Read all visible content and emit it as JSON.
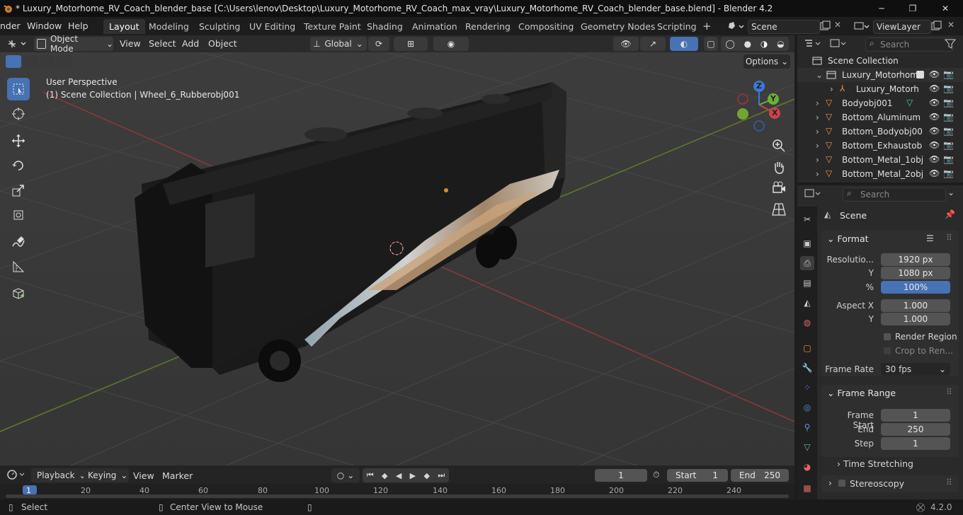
{
  "titlebar": {
    "title": "* Luxury_Motorhome_RV_Coach_blender_base [C:\\Users\\lenov\\Desktop\\Luxury_Motorhome_RV_Coach_max_vray\\Luxury_Motorhome_RV_Coach_blender_base.blend] - Blender 4.2",
    "minimize": "─",
    "maximize": "❐",
    "close": "✕"
  },
  "menubar": {
    "menus": [
      "nder",
      "Window",
      "Help"
    ],
    "workspaces": [
      "Layout",
      "Modeling",
      "Sculpting",
      "UV Editing",
      "Texture Paint",
      "Shading",
      "Animation",
      "Rendering",
      "Compositing",
      "Geometry Nodes",
      "Scripting"
    ],
    "active_workspace": "Layout",
    "add_tab": "+",
    "scene": "Scene",
    "view_layer": "ViewLayer"
  },
  "viewport": {
    "mode": "Object Mode",
    "menus": [
      "View",
      "Select",
      "Add",
      "Object"
    ],
    "transform": "Global",
    "options": "Options",
    "perspective": "User Perspective",
    "collection_info": "(1) Scene Collection | Wheel_6_Rubberobj001",
    "gizmo": {
      "x": "X",
      "y": "Y",
      "z": "Z"
    }
  },
  "outliner": {
    "search_placeholder": "Search",
    "root": "Scene Collection",
    "rows": [
      "Luxury_Motorhome",
      "Luxury_Motorh",
      "Bodyobj001",
      "Bottom_Aluminum",
      "Bottom_Bodyobj00",
      "Bottom_Exhaustob",
      "Bottom_Metal_1obj",
      "Bottom_Metal_2obj"
    ]
  },
  "properties": {
    "search_placeholder": "Search",
    "context": "Scene",
    "format": {
      "title": "Format",
      "res_label": "Resolutio...",
      "res_x": "1920 px",
      "y_label": "Y",
      "res_y": "1080 px",
      "pct_label": "%",
      "pct": "100%",
      "aspect_label": "Aspect X",
      "aspect_x": "1.000",
      "aspect_y": "1.000",
      "render_region": "Render Region",
      "crop": "Crop to Ren...",
      "fps_label": "Frame Rate",
      "fps": "30 fps"
    },
    "frame_range": {
      "title": "Frame Range",
      "start_label": "Frame Start",
      "start": "1",
      "end_label": "End",
      "end": "250",
      "step_label": "Step",
      "step": "1"
    },
    "time_stretching": "Time Stretching",
    "stereoscopy": "Stereoscopy"
  },
  "timeline": {
    "menus": [
      "Playback",
      "Keying",
      "View",
      "Marker"
    ],
    "current_frame": "1",
    "start_label": "Start",
    "start": "1",
    "end_label": "End",
    "end": "250",
    "ruler": [
      "1",
      "20",
      "40",
      "60",
      "80",
      "100",
      "120",
      "140",
      "160",
      "180",
      "200",
      "220",
      "240"
    ]
  },
  "statusbar": {
    "select": "Select",
    "center": "Center View to Mouse",
    "version": "4.2.0"
  }
}
